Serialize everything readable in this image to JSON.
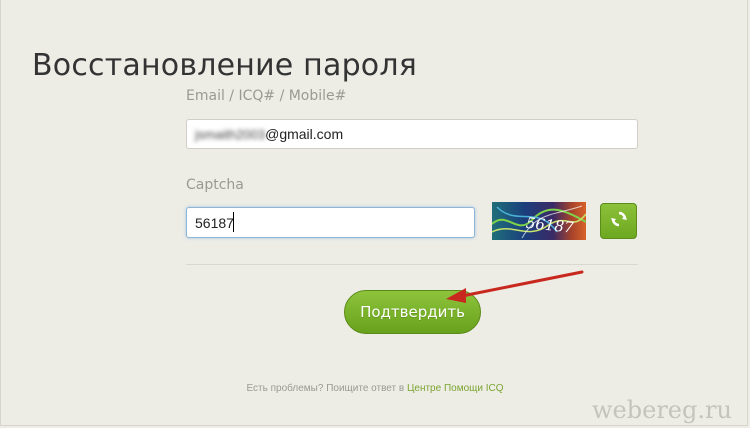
{
  "page": {
    "title": "Восстановление пароля"
  },
  "form": {
    "email_label": "Email / ICQ# / Mobile#",
    "email_blurred": "jsmaith2003",
    "email_domain": "@gmail.com",
    "captcha_label": "Captcha",
    "captcha_value": "56187",
    "captcha_image_text": "56187",
    "submit_label": "Подтвердить"
  },
  "help": {
    "prefix": "Есть проблемы? Поищите ответ в",
    "link": "Центре Помощи ICQ"
  },
  "watermark": "webereg.ru",
  "colors": {
    "accent_green": "#7ab32e",
    "link_green": "#7aa430",
    "arrow_red": "#c8281e"
  },
  "icons": {
    "refresh": "refresh-icon"
  }
}
